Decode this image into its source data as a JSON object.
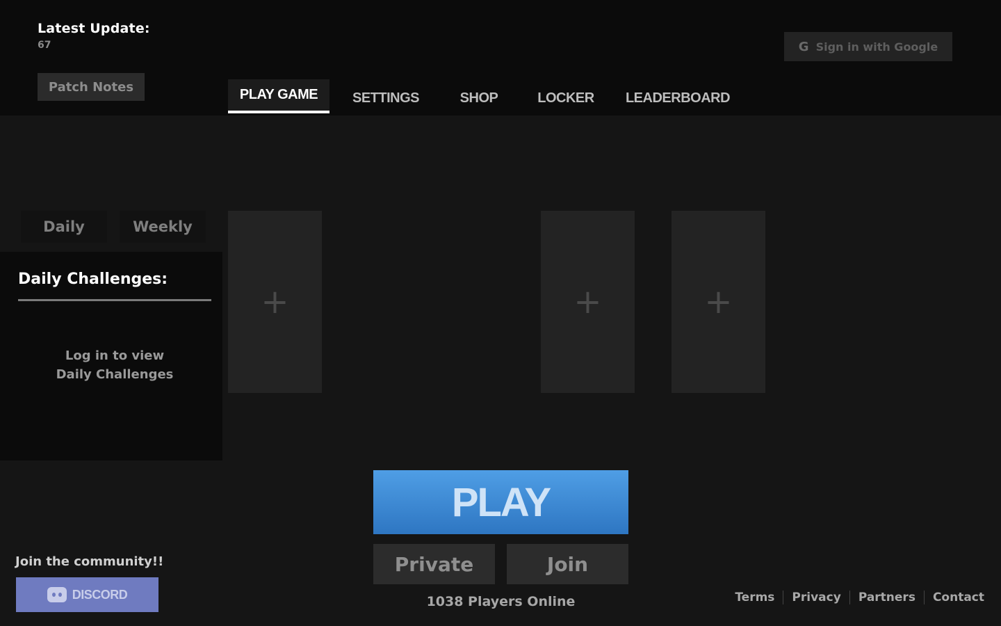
{
  "header": {
    "latest_update_label": "Latest Update:",
    "latest_update_value": "67",
    "patch_notes_label": "Patch Notes",
    "google_sign_in_label": "Sign in with Google",
    "google_icon_glyph": "G"
  },
  "tabs": [
    {
      "label": "PLAY GAME",
      "active": true
    },
    {
      "label": "SETTINGS",
      "active": false
    },
    {
      "label": "SHOP",
      "active": false
    },
    {
      "label": "LOCKER",
      "active": false
    },
    {
      "label": "LEADERBOARD",
      "active": false
    }
  ],
  "challenges": {
    "tabs": [
      {
        "label": "Daily"
      },
      {
        "label": "Weekly"
      }
    ],
    "title": "Daily Challenges:",
    "login_line1": "Log in to view",
    "login_line2": "Daily Challenges"
  },
  "slots": [
    {
      "icon": "plus-icon",
      "glyph": "+"
    },
    {
      "icon": "plus-icon",
      "glyph": "+"
    },
    {
      "icon": "plus-icon",
      "glyph": "+"
    }
  ],
  "play": {
    "play_label": "PLAY",
    "private_label": "Private",
    "join_label": "Join",
    "players_online": "1038 Players Online"
  },
  "community": {
    "label": "Join the community!!",
    "discord_label": "DISCORD"
  },
  "footer": {
    "links": [
      {
        "label": "Terms"
      },
      {
        "label": "Privacy"
      },
      {
        "label": "Partners"
      },
      {
        "label": "Contact"
      }
    ]
  },
  "colors": {
    "background": "#151515",
    "header_background": "#0b0b0b",
    "play_button": "#3f8bd6",
    "discord": "#6f7bc0"
  }
}
